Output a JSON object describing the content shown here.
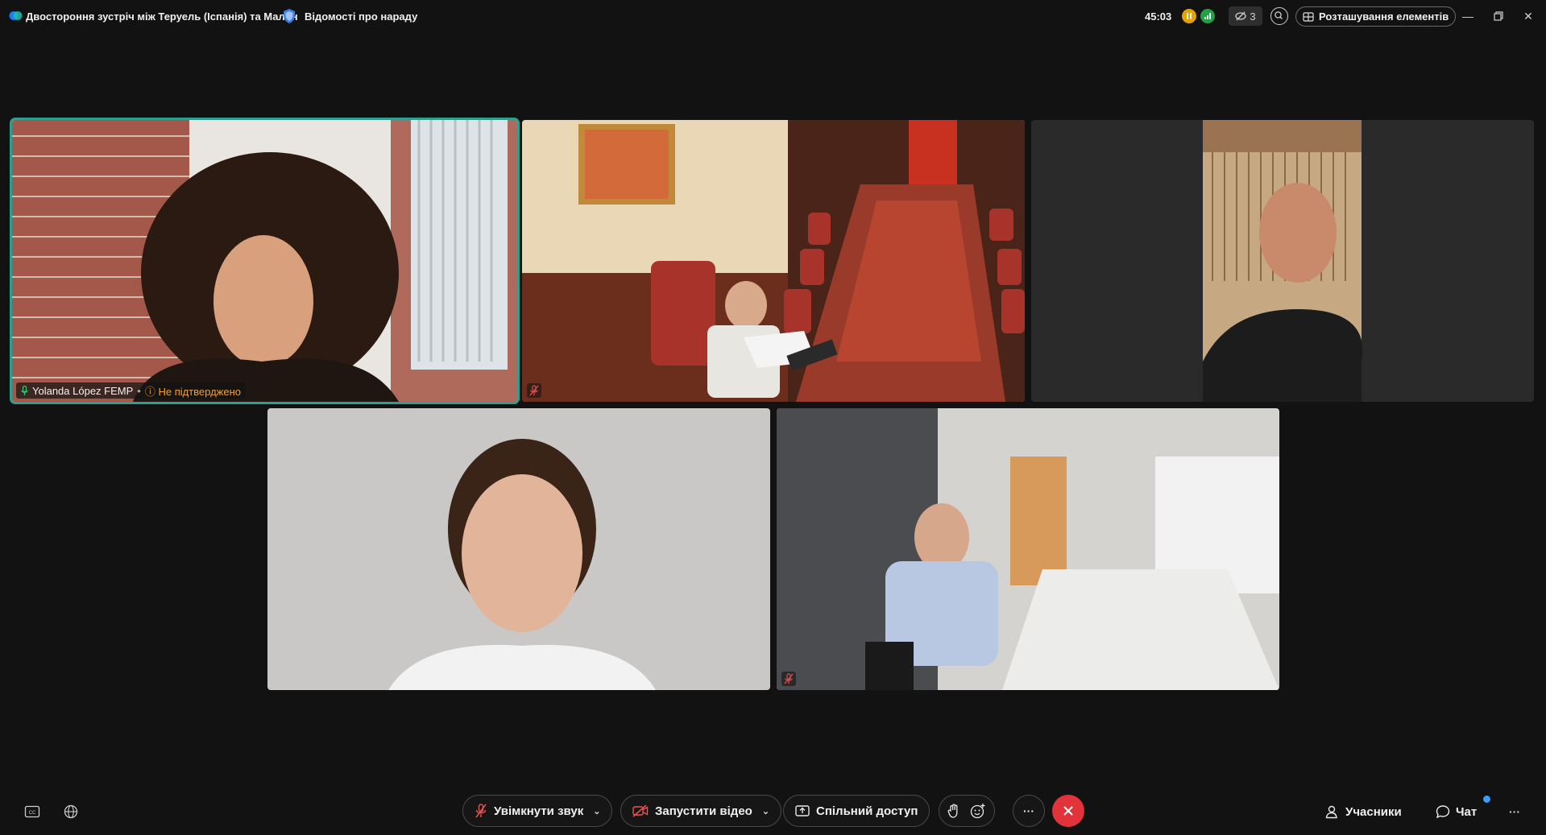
{
  "titlebar": {
    "meeting_title": "Двостороння зустріч між Теруель (Іспанія) та Малин",
    "meeting_info": "Відомості про нараду",
    "timer": "45:03",
    "hidden_participants": "3",
    "layout_label": "Розташування елементів"
  },
  "participants": [
    {
      "name": "Yolanda López FEMP",
      "status": "Не підтверджено",
      "muted": false,
      "active_speaker": true
    },
    {
      "muted": true
    },
    {
      "muted": false
    },
    {
      "muted": false
    },
    {
      "muted": true
    }
  ],
  "controls": {
    "unmute_label": "Увімкнути звук",
    "video_label": "Запустити відео",
    "share_label": "Спільний доступ",
    "participants_label": "Учасники",
    "chat_label": "Чат",
    "more_label": "···"
  },
  "colors": {
    "background": "#121212",
    "active_speaker_border": "#2e9e8f",
    "leave_button": "#e2333b",
    "recording_pause": "#e8a200",
    "unverified_text": "#f0a030",
    "chat_notification": "#3b9cff"
  },
  "icons": [
    "webex-logo-icon",
    "shield-icon",
    "pause-icon",
    "signal-icon",
    "eye-off-icon",
    "search-icon",
    "layout-grid-icon",
    "minimize-icon",
    "restore-icon",
    "close-icon",
    "microphone-muted-icon",
    "video-off-icon",
    "share-screen-icon",
    "raise-hand-icon",
    "reactions-icon",
    "more-icon",
    "leave-icon",
    "captions-icon",
    "globe-icon",
    "people-icon",
    "chat-icon"
  ]
}
